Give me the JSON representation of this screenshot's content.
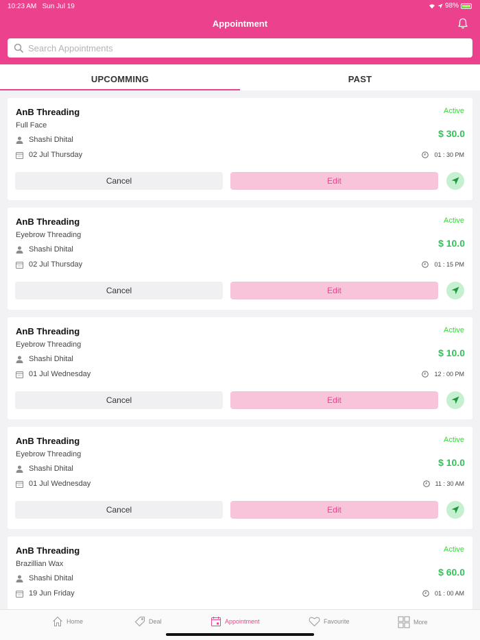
{
  "status_bar": {
    "time": "10:23 AM",
    "date": "Sun Jul 19",
    "battery": "98%"
  },
  "header": {
    "title": "Appointment"
  },
  "search": {
    "placeholder": "Search Appointments"
  },
  "tabs": [
    {
      "label": "UPCOMMING",
      "active": true
    },
    {
      "label": "PAST",
      "active": false
    }
  ],
  "appointments": [
    {
      "shop": "AnB Threading",
      "service": "Full Face",
      "staff": "Shashi Dhital",
      "date": "02 Jul  Thursday",
      "time": "01 : 30 PM",
      "status": "Active",
      "price": "$ 30.0",
      "cancel_label": "Cancel",
      "edit_label": "Edit"
    },
    {
      "shop": "AnB Threading",
      "service": "Eyebrow Threading",
      "staff": "Shashi Dhital",
      "date": "02 Jul  Thursday",
      "time": "01 : 15 PM",
      "status": "Active",
      "price": "$ 10.0",
      "cancel_label": "Cancel",
      "edit_label": "Edit"
    },
    {
      "shop": "AnB Threading",
      "service": "Eyebrow Threading",
      "staff": "Shashi Dhital",
      "date": "01 Jul  Wednesday",
      "time": "12 : 00 PM",
      "status": "Active",
      "price": "$ 10.0",
      "cancel_label": "Cancel",
      "edit_label": "Edit"
    },
    {
      "shop": "AnB Threading",
      "service": "Eyebrow Threading",
      "staff": "Shashi Dhital",
      "date": "01 Jul  Wednesday",
      "time": "11 : 30 AM",
      "status": "Active",
      "price": "$ 10.0",
      "cancel_label": "Cancel",
      "edit_label": "Edit"
    },
    {
      "shop": "AnB Threading",
      "service": "Brazillian Wax",
      "staff": "Shashi Dhital",
      "date": "19 Jun  Friday",
      "time": "01 : 00 AM",
      "status": "Active",
      "price": "$ 60.0"
    }
  ],
  "tab_bar": [
    {
      "label": "Home",
      "icon": "home-icon"
    },
    {
      "label": "Deal",
      "icon": "tag-icon"
    },
    {
      "label": "Appointment",
      "icon": "calendar-icon",
      "active": true
    },
    {
      "label": "Favourite",
      "icon": "heart-icon"
    },
    {
      "label": "More",
      "icon": "grid-icon"
    }
  ],
  "colors": {
    "brand": "#ec418c",
    "price": "#35c05b",
    "status_active": "#2ee02e",
    "edit_bg": "#f8c4da",
    "nav_bg": "#c6f0cf"
  }
}
